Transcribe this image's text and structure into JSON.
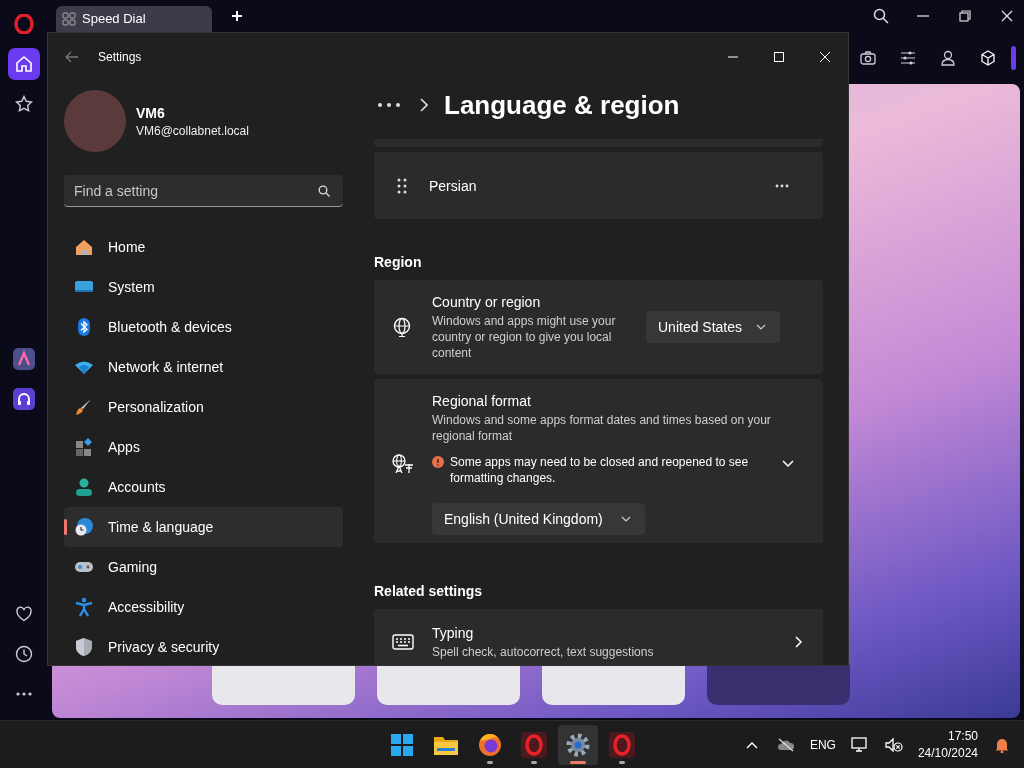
{
  "browser": {
    "tabs": [
      {
        "title": "Speed Dial",
        "selected": true
      }
    ],
    "sidebar": [
      {
        "kind": "logo",
        "selected": false
      },
      {
        "kind": "home",
        "selected": true
      },
      {
        "kind": "star",
        "selected": false
      },
      {
        "kind": "aria",
        "selected": false
      },
      {
        "kind": "player",
        "selected": false
      },
      {
        "kind": "heart",
        "selected": false
      },
      {
        "kind": "clock",
        "selected": false
      },
      {
        "kind": "more",
        "selected": false
      }
    ]
  },
  "settings": {
    "title": "Settings",
    "user": {
      "name": "VM6",
      "email": "VM6@collabnet.local"
    },
    "search": {
      "placeholder": "Find a setting"
    },
    "nav": [
      {
        "label": "Home",
        "kind": "home",
        "selected": false
      },
      {
        "label": "System",
        "kind": "system",
        "selected": false
      },
      {
        "label": "Bluetooth & devices",
        "kind": "bluetooth",
        "selected": false
      },
      {
        "label": "Network & internet",
        "kind": "network",
        "selected": false
      },
      {
        "label": "Personalization",
        "kind": "brush",
        "selected": false
      },
      {
        "label": "Apps",
        "kind": "apps",
        "selected": false
      },
      {
        "label": "Accounts",
        "kind": "accounts",
        "selected": false
      },
      {
        "label": "Time & language",
        "kind": "time",
        "selected": true
      },
      {
        "label": "Gaming",
        "kind": "gaming",
        "selected": false
      },
      {
        "label": "Accessibility",
        "kind": "accessibility",
        "selected": false
      },
      {
        "label": "Privacy & security",
        "kind": "privacy",
        "selected": false
      }
    ],
    "page": {
      "title": "Language & region"
    },
    "languages": [
      {
        "name": "Persian"
      }
    ],
    "sections": [
      {
        "heading": "Region",
        "cards": [
          {
            "kind": "dropdown",
            "title": "Country or region",
            "description": "Windows and apps might use your country or region to give you local content",
            "value": "United States"
          },
          {
            "kind": "format",
            "title": "Regional format",
            "description": "Windows and some apps format dates and times based on your regional format",
            "warning": "Some apps may need to be closed and reopened to see formatting changes.",
            "value": "English (United Kingdom)"
          }
        ]
      },
      {
        "heading": "Related settings",
        "cards": [
          {
            "kind": "link",
            "title": "Typing",
            "description": "Spell check, autocorrect, text suggestions"
          }
        ]
      }
    ]
  },
  "taskbar": {
    "apps": [
      {
        "kind": "start",
        "running": false,
        "active": false
      },
      {
        "kind": "files",
        "running": false,
        "active": false
      },
      {
        "kind": "firefox",
        "running": true,
        "active": false
      },
      {
        "kind": "opera",
        "running": true,
        "active": false
      },
      {
        "kind": "settings",
        "running": true,
        "active": true
      },
      {
        "kind": "opera",
        "running": true,
        "active": false
      }
    ],
    "tray": {
      "language": "ENG",
      "time": "17:50",
      "date": "24/10/2024"
    }
  }
}
